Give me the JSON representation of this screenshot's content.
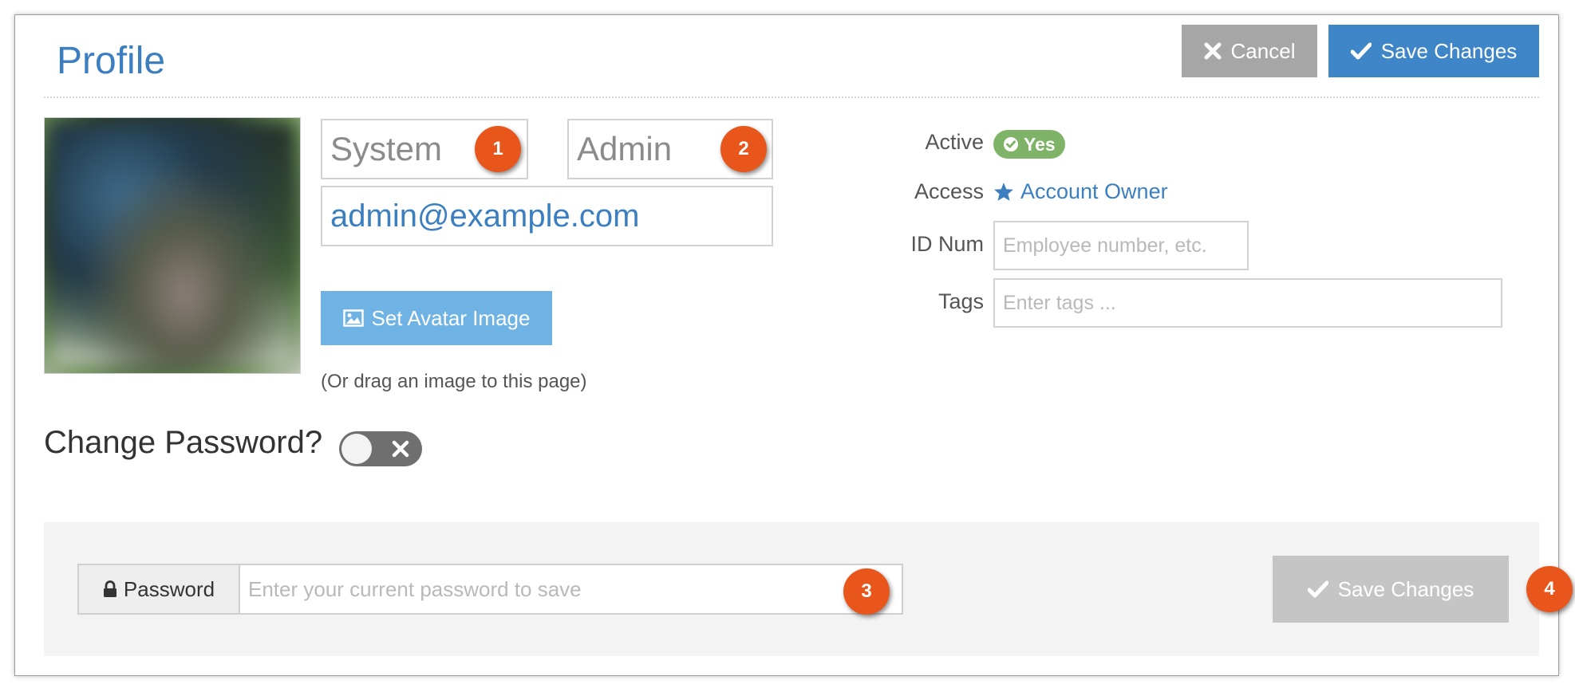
{
  "header": {
    "title": "Profile",
    "cancel_label": "Cancel",
    "save_label": "Save Changes"
  },
  "profile": {
    "first_name": "System",
    "last_name": "Admin",
    "email": "admin@example.com",
    "set_avatar_label": "Set Avatar Image",
    "drag_hint": "(Or drag an image to this page)"
  },
  "details": {
    "active_label": "Active",
    "active_value": "Yes",
    "access_label": "Access",
    "access_value": "Account Owner",
    "idnum_label": "ID Num",
    "idnum_placeholder": "Employee number, etc.",
    "tags_label": "Tags",
    "tags_placeholder": "Enter tags ..."
  },
  "password": {
    "toggle_label": "Change Password?",
    "toggle_on": false,
    "addon_label": "Password",
    "placeholder": "Enter your current password to save",
    "save_label": "Save Changes"
  },
  "markers": [
    "1",
    "2",
    "3",
    "4"
  ],
  "colors": {
    "accent": "#3f86c9",
    "title": "#3b7fc0",
    "cancel": "#a6a6a6",
    "success": "#7fb368",
    "marker": "#e8561b",
    "disabled": "#c5c5c5"
  },
  "icons": {
    "cancel": "x-icon",
    "save": "check-icon",
    "avatar": "image-icon",
    "active": "check-circle-icon",
    "access": "star-icon",
    "toggle": "x-icon",
    "password": "lock-icon"
  }
}
